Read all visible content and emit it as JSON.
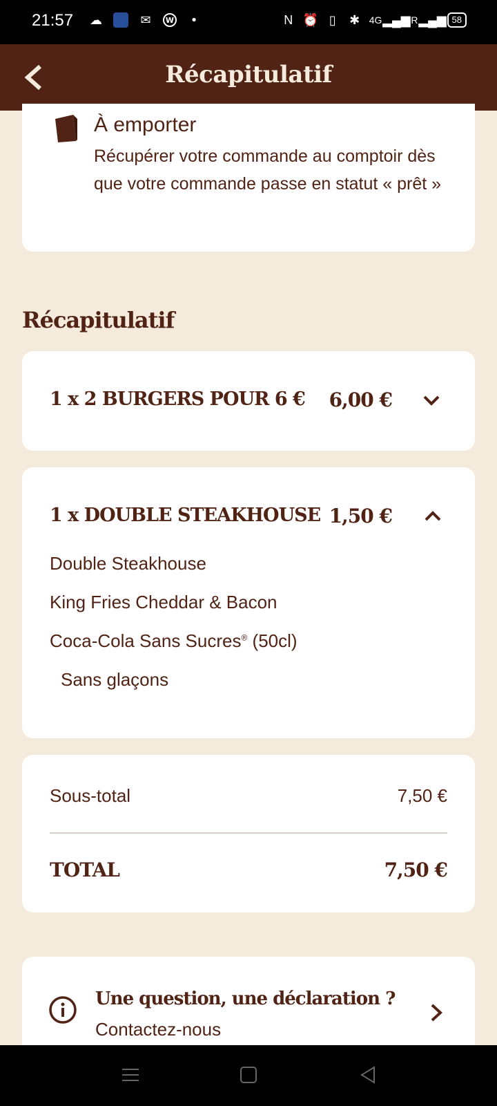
{
  "status_bar": {
    "time": "21:57",
    "network": "4G",
    "roaming": "R",
    "battery": "58"
  },
  "header": {
    "title": "Récapitulatif"
  },
  "pickup": {
    "title": "À emporter",
    "description": "Récupérer votre commande au comptoir dès que votre commande passe en statut « prêt »"
  },
  "summary": {
    "section_title": "Récapitulatif",
    "items": [
      {
        "label": "1 x 2 BURGERS POUR 6 €",
        "price": "6,00 €",
        "expanded": false
      },
      {
        "label": "1 x DOUBLE STEAKHOUSE",
        "price": "1,50 €",
        "expanded": true,
        "details": [
          "Double Steakhouse",
          "King Fries Cheddar & Bacon",
          "Coca-Cola Sans Sucres",
          "(50cl)",
          "Sans glaçons"
        ],
        "registered_mark": "®"
      }
    ]
  },
  "totals": {
    "subtotal_label": "Sous-total",
    "subtotal_value": "7,50 €",
    "total_label": "TOTAL",
    "total_value": "7,50 €"
  },
  "contact": {
    "title": "Une question, une déclaration ?",
    "subtitle": "Contactez-nous"
  },
  "colors": {
    "brand_brown": "#502314",
    "background": "#f5ebdc"
  }
}
